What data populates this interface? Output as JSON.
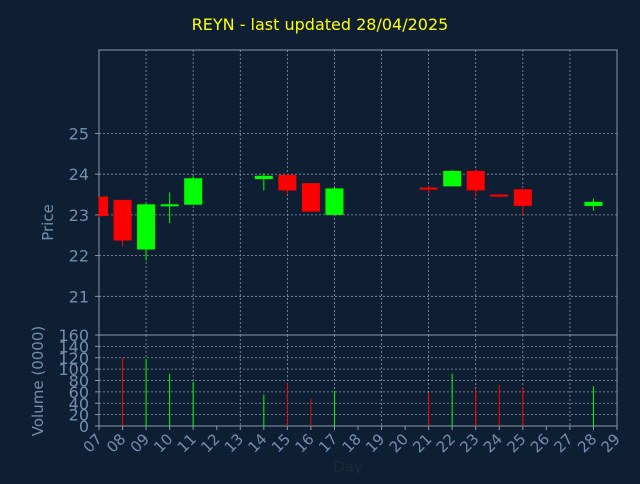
{
  "chart_data": {
    "type": "candlestick",
    "title": "REYN - last updated 28/04/2025",
    "xlabel": "Day",
    "ylabel_price": "Price",
    "ylabel_volume": "Volume (0000)",
    "x_ticks": [
      "07",
      "08",
      "09",
      "10",
      "11",
      "12",
      "13",
      "14",
      "15",
      "16",
      "17",
      "18",
      "19",
      "20",
      "21",
      "22",
      "23",
      "24",
      "25",
      "26",
      "27",
      "28",
      "29"
    ],
    "price_ticks": [
      21,
      22,
      23,
      24,
      25
    ],
    "price_range": [
      20.05,
      27.05
    ],
    "volume_ticks": [
      0,
      20,
      40,
      60,
      80,
      100,
      120,
      140,
      160
    ],
    "volume_range": [
      0,
      160
    ],
    "grid": true,
    "colors": {
      "up": "#00ff00",
      "down": "#ff0000",
      "background": "#0f1f33",
      "title": "#ffff00",
      "label": "#6f8fb0",
      "grid": "#8a9aaa"
    },
    "candles": [
      {
        "day": "07",
        "open": 23.45,
        "high": 23.45,
        "low": 22.95,
        "close": 22.97,
        "volume": 0
      },
      {
        "day": "08",
        "open": 23.37,
        "high": 23.37,
        "low": 22.22,
        "close": 22.37,
        "volume": 120
      },
      {
        "day": "09",
        "open": 22.15,
        "high": 23.3,
        "low": 21.88,
        "close": 23.26,
        "volume": 118
      },
      {
        "day": "10",
        "open": 23.24,
        "high": 23.55,
        "low": 22.8,
        "close": 23.26,
        "volume": 92
      },
      {
        "day": "11",
        "open": 23.25,
        "high": 23.95,
        "low": 23.25,
        "close": 23.9,
        "volume": 78
      },
      {
        "day": "14",
        "open": 23.88,
        "high": 24.02,
        "low": 23.6,
        "close": 23.96,
        "volume": 55
      },
      {
        "day": "15",
        "open": 23.98,
        "high": 24.0,
        "low": 23.5,
        "close": 23.6,
        "volume": 75
      },
      {
        "day": "16",
        "open": 23.78,
        "high": 23.78,
        "low": 23.08,
        "close": 23.08,
        "volume": 48
      },
      {
        "day": "17",
        "open": 23.0,
        "high": 23.68,
        "low": 23.0,
        "close": 23.65,
        "volume": 62
      },
      {
        "day": "21",
        "open": 23.67,
        "high": 23.72,
        "low": 23.5,
        "close": 23.65,
        "volume": 58
      },
      {
        "day": "22",
        "open": 23.7,
        "high": 24.1,
        "low": 23.7,
        "close": 24.08,
        "volume": 92
      },
      {
        "day": "23",
        "open": 24.08,
        "high": 24.12,
        "low": 23.45,
        "close": 23.6,
        "volume": 65
      },
      {
        "day": "24",
        "open": 23.5,
        "high": 23.5,
        "low": 23.43,
        "close": 23.45,
        "volume": 72
      },
      {
        "day": "25",
        "open": 23.63,
        "high": 23.63,
        "low": 22.98,
        "close": 23.22,
        "volume": 68
      },
      {
        "day": "28",
        "open": 23.22,
        "high": 23.4,
        "low": 23.1,
        "close": 23.32,
        "volume": 70
      }
    ]
  }
}
